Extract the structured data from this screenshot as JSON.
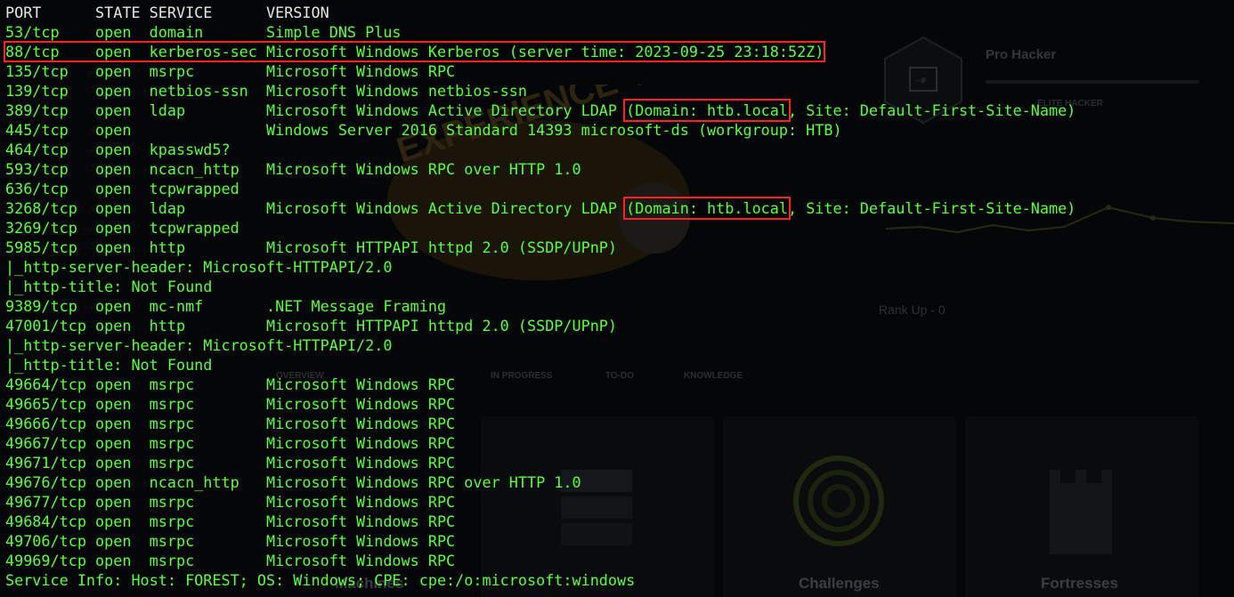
{
  "background": {
    "profile_name": "Pro Hacker",
    "profile_rank": "ELITE HACKER",
    "rank_up": "Rank Up - 0",
    "tabs": [
      "OVERVIEW",
      "IN PROGRESS",
      "TO-DO",
      "KNOWLEDGE"
    ],
    "cards": [
      "Machines",
      "Challenges",
      "Fortresses"
    ],
    "hex_icon": "~#",
    "banner": "EXPERIENCE VIP"
  },
  "terminal": {
    "header": "PORT      STATE SERVICE      VERSION",
    "lines": [
      "53/tcp    open  domain       Simple DNS Plus",
      "88/tcp    open  kerberos-sec Microsoft Windows Kerberos (server time: 2023-09-25 23:18:52Z)",
      "135/tcp   open  msrpc        Microsoft Windows RPC",
      "139/tcp   open  netbios-ssn  Microsoft Windows netbios-ssn",
      "389/tcp   open  ldap         Microsoft Windows Active Directory LDAP ",
      "445/tcp   open               Windows Server 2016 Standard 14393 microsoft-ds (workgroup: HTB)",
      "464/tcp   open  kpasswd5?",
      "593/tcp   open  ncacn_http   Microsoft Windows RPC over HTTP 1.0",
      "636/tcp   open  tcpwrapped",
      "3268/tcp  open  ldap         Microsoft Windows Active Directory LDAP ",
      "3269/tcp  open  tcpwrapped",
      "5985/tcp  open  http         Microsoft HTTPAPI httpd 2.0 (SSDP/UPnP)",
      "|_http-server-header: Microsoft-HTTPAPI/2.0",
      "|_http-title: Not Found",
      "9389/tcp  open  mc-nmf       .NET Message Framing",
      "47001/tcp open  http         Microsoft HTTPAPI httpd 2.0 (SSDP/UPnP)",
      "|_http-server-header: Microsoft-HTTPAPI/2.0",
      "|_http-title: Not Found",
      "49664/tcp open  msrpc        Microsoft Windows RPC",
      "49665/tcp open  msrpc        Microsoft Windows RPC",
      "49666/tcp open  msrpc        Microsoft Windows RPC",
      "49667/tcp open  msrpc        Microsoft Windows RPC",
      "49671/tcp open  msrpc        Microsoft Windows RPC",
      "49676/tcp open  ncacn_http   Microsoft Windows RPC over HTTP 1.0",
      "49677/tcp open  msrpc        Microsoft Windows RPC",
      "49684/tcp open  msrpc        Microsoft Windows RPC",
      "49706/tcp open  msrpc        Microsoft Windows RPC",
      "49969/tcp open  msrpc        Microsoft Windows RPC",
      "Service Info: Host: FOREST; OS: Windows; CPE: cpe:/o:microsoft:windows"
    ],
    "ldap_domain": "(Domain: htb.local",
    "ldap_site": ", Site: Default-First-Site-Name)"
  },
  "colors": {
    "terminal_text": "#58ff3a",
    "header_text": "#e6e6e6",
    "highlight_box": "#ff2020",
    "background": "#000000"
  }
}
